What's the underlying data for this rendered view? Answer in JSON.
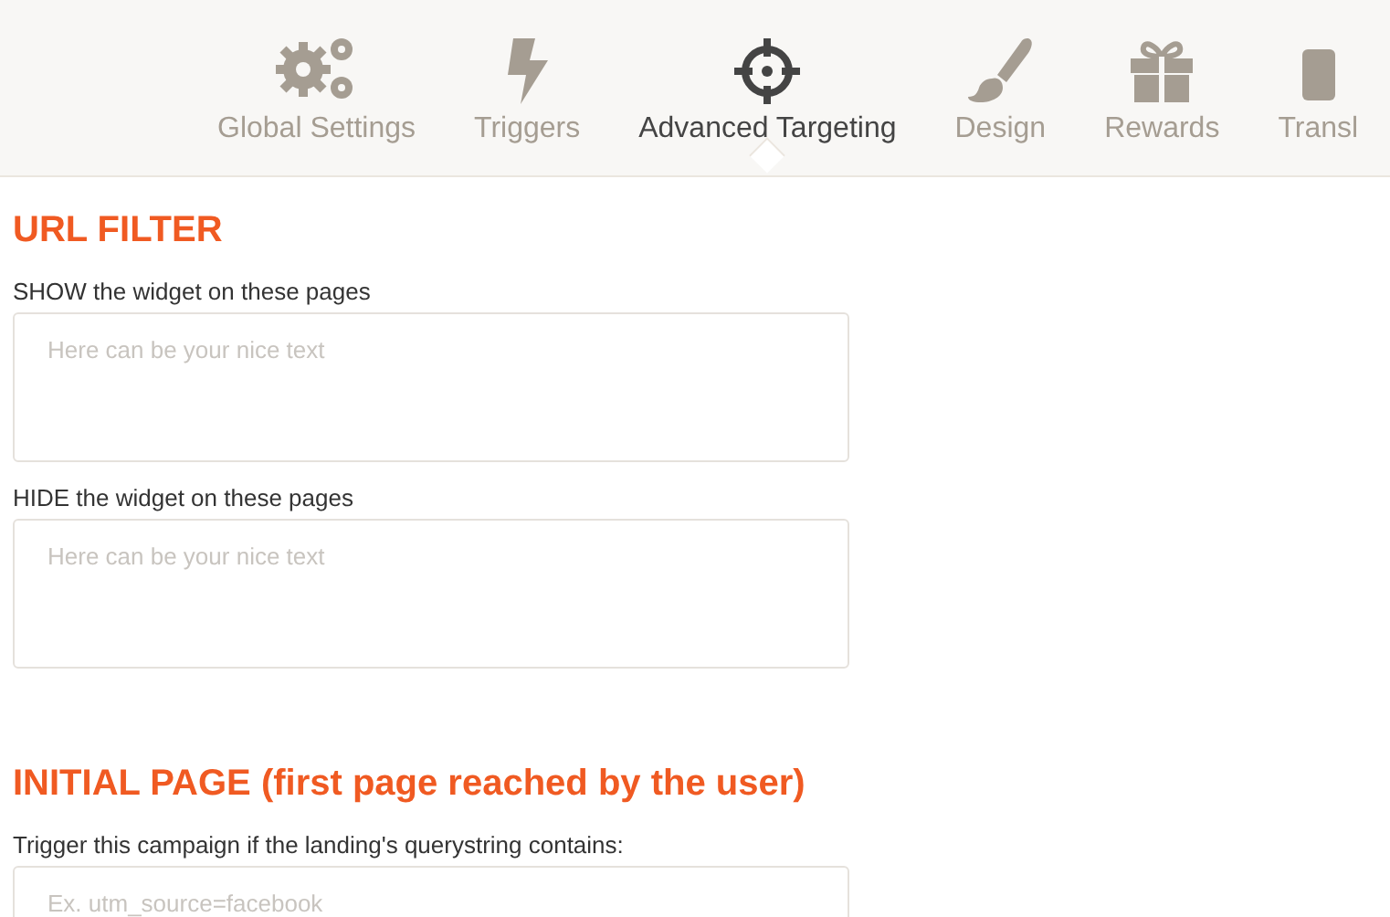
{
  "tabs": [
    {
      "label": "Global Settings",
      "selected": false
    },
    {
      "label": "Triggers",
      "selected": false
    },
    {
      "label": "Advanced Targeting",
      "selected": true
    },
    {
      "label": "Design",
      "selected": false
    },
    {
      "label": "Rewards",
      "selected": false
    },
    {
      "label": "Transl",
      "selected": false
    }
  ],
  "sections": [
    {
      "title": "URL FILTER",
      "fields": [
        {
          "label": "SHOW the widget on these pages",
          "placeholder": "Here can be your nice text",
          "kind": "textarea"
        },
        {
          "label": "HIDE the widget on these pages",
          "placeholder": "Here can be your nice text",
          "kind": "textarea"
        }
      ]
    },
    {
      "title": "INITIAL PAGE (first page reached by the user)",
      "fields": [
        {
          "label": "Trigger this campaign if the landing's querystring contains:",
          "placeholder": "Ex. utm_source=facebook",
          "kind": "input"
        }
      ]
    }
  ]
}
